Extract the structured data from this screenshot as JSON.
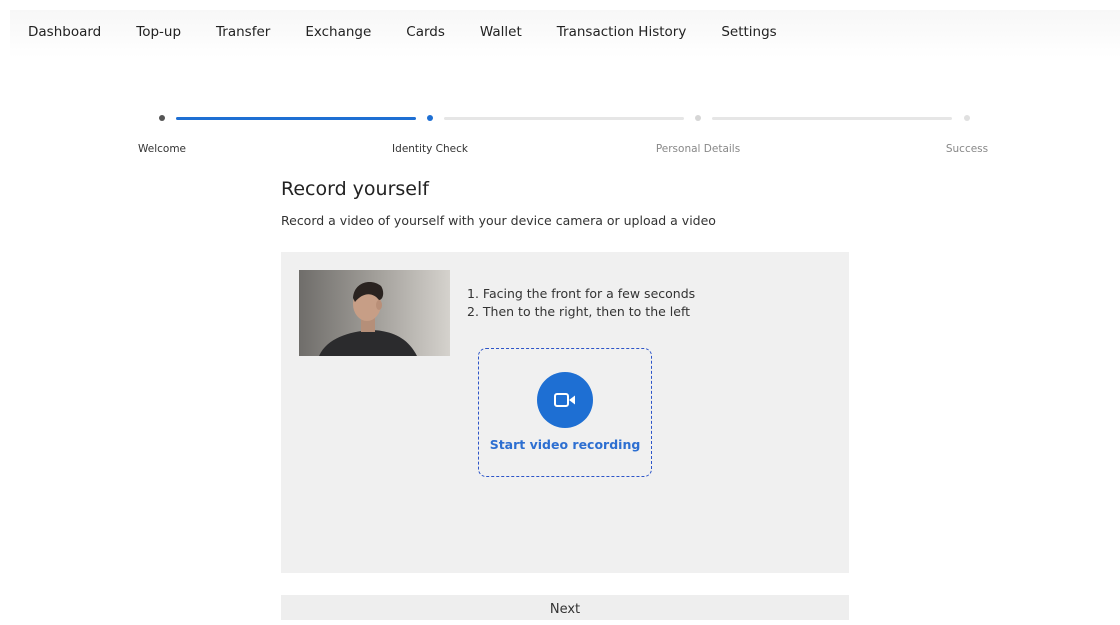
{
  "nav": {
    "items": [
      {
        "label": "Dashboard"
      },
      {
        "label": "Top-up"
      },
      {
        "label": "Transfer"
      },
      {
        "label": "Exchange"
      },
      {
        "label": "Cards"
      },
      {
        "label": "Wallet"
      },
      {
        "label": "Transaction History"
      },
      {
        "label": "Settings"
      }
    ]
  },
  "stepper": {
    "steps": [
      {
        "label": "Welcome",
        "state": "completed"
      },
      {
        "label": "Identity Check",
        "state": "current"
      },
      {
        "label": "Personal Details",
        "state": "upcoming"
      },
      {
        "label": "Success",
        "state": "upcoming"
      }
    ]
  },
  "page": {
    "title": "Record yourself",
    "subtitle": "Record a video of yourself with your device camera or upload a video"
  },
  "instructions": {
    "line1": "1. Facing the front for a few seconds",
    "line2": "2. Then to the right, then to the left"
  },
  "recorder": {
    "label": "Start video recording",
    "icon": "video-camera-icon"
  },
  "actions": {
    "next_label": "Next"
  },
  "colors": {
    "accent": "#1e6fd3",
    "dashed_border": "#2d55c8",
    "panel_bg": "#f0f0f0"
  }
}
